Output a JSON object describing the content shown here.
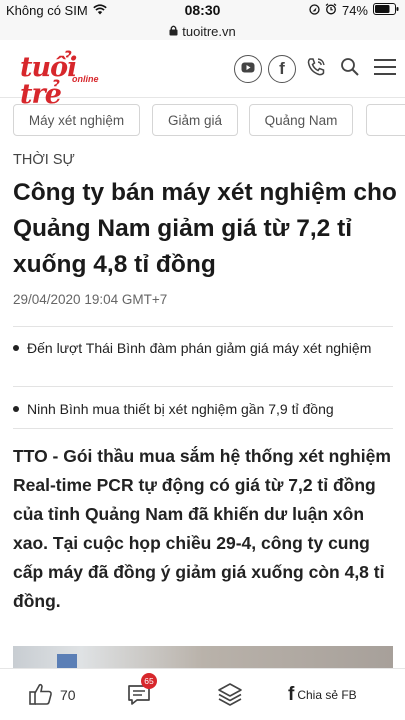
{
  "status_bar": {
    "carrier": "Không có SIM",
    "time": "08:30",
    "battery": "74%",
    "url": "tuoitre.vn"
  },
  "header": {
    "logo_text": "tuổi trẻ",
    "logo_sub": "online",
    "icons": [
      "youtube-icon",
      "facebook-icon",
      "phone-icon",
      "search-icon",
      "menu-icon"
    ]
  },
  "tags": [
    "Máy xét nghiệm",
    "Giảm giá",
    "Quảng Nam"
  ],
  "article": {
    "section": "THỜI SỰ",
    "title": "Công ty bán máy xét nghiệm cho Quảng Nam giảm giá từ 7,2 tỉ xuống 4,8 tỉ đồng",
    "date": "29/04/2020 19:04 GMT+7",
    "related": [
      "Đến lượt Thái Bình đàm phán giảm giá máy xét nghiệm",
      "Ninh Bình mua thiết bị xét nghiệm gần 7,9 tỉ đồng"
    ],
    "sapo": "TTO - Gói thầu mua sắm hệ thống xét nghiệm Real-time PCR tự động có giá từ 7,2 tỉ đồng của tỉnh Quảng Nam đã khiến dư luận xôn xao. Tại cuộc họp chiều 29-4, công ty cung cấp máy đã đồng ý giảm giá xuống còn 4,8 tỉ đồng."
  },
  "bottom_bar": {
    "like_count": "70",
    "comment_badge": "65",
    "share_label": "Chia sẻ FB"
  },
  "colors": {
    "brand": "#d7272c",
    "text": "#222222",
    "muted": "#666666"
  }
}
